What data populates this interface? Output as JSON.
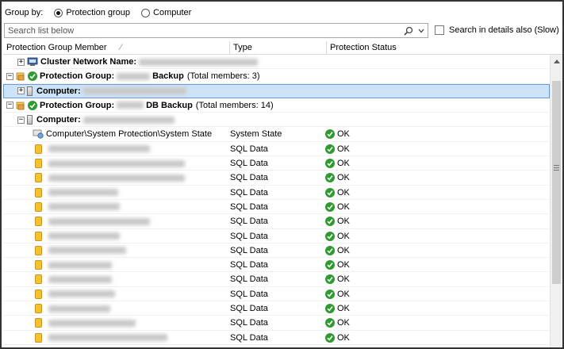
{
  "groupby": {
    "label": "Group by:",
    "options": [
      "Protection group",
      "Computer"
    ],
    "selected": "Protection group"
  },
  "search": {
    "placeholder": "Search list below",
    "details_label": "Search in details also (Slow)",
    "details_checked": false
  },
  "columns": {
    "member": "Protection Group Member",
    "type": "Type",
    "status": "Protection Status"
  },
  "rows": [
    {
      "kind": "cluster",
      "label": "Cluster Network Name:",
      "collapsed": true
    },
    {
      "kind": "group",
      "label": "Protection Group:",
      "name_suffix": "Backup",
      "note": "(Total members: 3)"
    },
    {
      "kind": "computer",
      "label": "Computer:",
      "selected": true,
      "collapsed": true
    },
    {
      "kind": "group",
      "label": "Protection Group:",
      "name_suffix": "DB Backup",
      "note": "(Total members: 14)"
    },
    {
      "kind": "computer",
      "label": "Computer:",
      "selected": false,
      "collapsed": false
    },
    {
      "kind": "item",
      "member": "Computer\\System Protection\\System State",
      "type": "System State",
      "status": "OK",
      "icon": "system-state-icon"
    },
    {
      "kind": "item",
      "member": "",
      "type": "SQL Data",
      "status": "OK",
      "icon": "database-icon"
    },
    {
      "kind": "item",
      "member": "",
      "type": "SQL Data",
      "status": "OK",
      "icon": "database-icon"
    },
    {
      "kind": "item",
      "member": "",
      "type": "SQL Data",
      "status": "OK",
      "icon": "database-icon"
    },
    {
      "kind": "item",
      "member": "",
      "type": "SQL Data",
      "status": "OK",
      "icon": "database-icon"
    },
    {
      "kind": "item",
      "member": "",
      "type": "SQL Data",
      "status": "OK",
      "icon": "database-icon"
    },
    {
      "kind": "item",
      "member": "",
      "type": "SQL Data",
      "status": "OK",
      "icon": "database-icon"
    },
    {
      "kind": "item",
      "member": "",
      "type": "SQL Data",
      "status": "OK",
      "icon": "database-icon"
    },
    {
      "kind": "item",
      "member": "",
      "type": "SQL Data",
      "status": "OK",
      "icon": "database-icon"
    },
    {
      "kind": "item",
      "member": "",
      "type": "SQL Data",
      "status": "OK",
      "icon": "database-icon"
    },
    {
      "kind": "item",
      "member": "",
      "type": "SQL Data",
      "status": "OK",
      "icon": "database-icon"
    },
    {
      "kind": "item",
      "member": "",
      "type": "SQL Data",
      "status": "OK",
      "icon": "database-icon"
    },
    {
      "kind": "item",
      "member": "",
      "type": "SQL Data",
      "status": "OK",
      "icon": "database-icon"
    },
    {
      "kind": "item",
      "member": "",
      "type": "SQL Data",
      "status": "OK",
      "icon": "database-icon"
    },
    {
      "kind": "item",
      "member": "",
      "type": "SQL Data",
      "status": "OK",
      "icon": "database-icon"
    }
  ],
  "colors": {
    "ok_green": "#2f9a2f",
    "selection": "#cde3f7",
    "selection_border": "#6a9bd1",
    "db_yellow": "#f2c230"
  }
}
